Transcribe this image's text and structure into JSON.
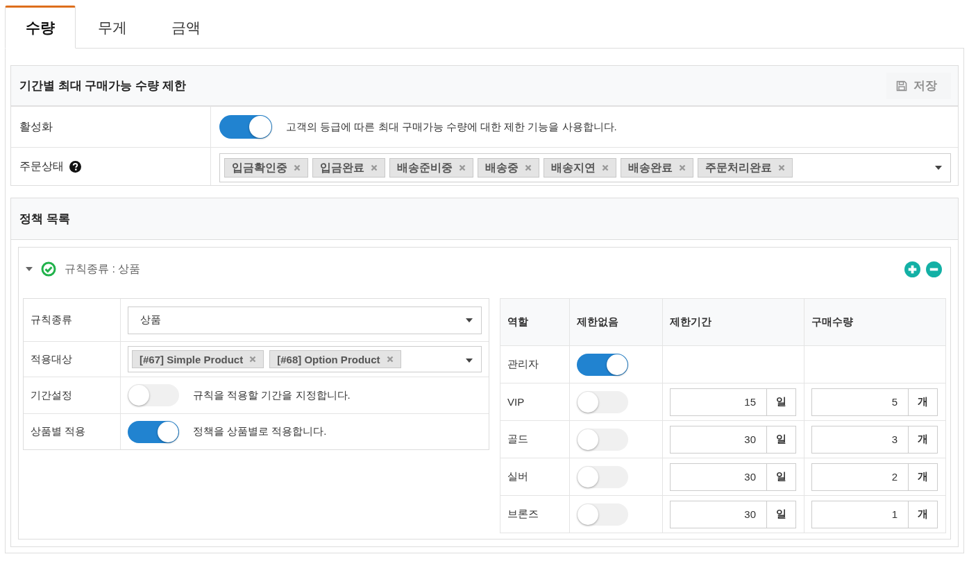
{
  "tabs": [
    {
      "label": "수량",
      "selected": true
    },
    {
      "label": "무게",
      "selected": false
    },
    {
      "label": "금액",
      "selected": false
    }
  ],
  "limit_panel": {
    "title": "기간별 최대 구매가능 수량 제한",
    "save_button": {
      "label": "저장",
      "disabled": true
    },
    "rows": [
      {
        "kind": "toggle",
        "label": "활성화",
        "on": true,
        "description": "고객의 등급에 따른 최대 구매가능 수량에 대한 제한 기능을 사용합니다."
      },
      {
        "kind": "tags",
        "label": "주문상태",
        "tags": [
          "입금확인중",
          "입금완료",
          "배송준비중",
          "배송중",
          "배송지연",
          "배송완료",
          "주문처리완료"
        ]
      }
    ]
  },
  "policy_panel": {
    "title": "정책 목록",
    "rules": [
      {
        "expanded": true,
        "summary": "규칙종류 : 상품",
        "settings": [
          {
            "kind": "select",
            "label": "규칙종류",
            "value": "상품"
          },
          {
            "kind": "tags",
            "label": "적용대상",
            "tags": [
              "[#67] Simple Product",
              "[#68] Option Product"
            ]
          },
          {
            "kind": "toggle",
            "label": "기간설정",
            "on": false,
            "description": "규칙을 적용할 기간을 지정합니다."
          },
          {
            "kind": "toggle",
            "label": "상품별 적용",
            "on": true,
            "description": "정책을 상품별로 적용합니다."
          }
        ],
        "roles": {
          "columns": [
            "역할",
            "제한없음",
            "제한기간",
            "구매수량"
          ],
          "rows": [
            {
              "role": "관리자",
              "unlimited": true
            },
            {
              "role": "VIP",
              "unlimited": false,
              "period": "15",
              "period_unit": "일",
              "quantity": "5",
              "quantity_unit": "개"
            },
            {
              "role": "골드",
              "unlimited": false,
              "period": "30",
              "period_unit": "일",
              "quantity": "3",
              "quantity_unit": "개"
            },
            {
              "role": "실버",
              "unlimited": false,
              "period": "30",
              "period_unit": "일",
              "quantity": "2",
              "quantity_unit": "개"
            },
            {
              "role": "브론즈",
              "unlimited": false,
              "period": "30",
              "period_unit": "일",
              "quantity": "1",
              "quantity_unit": "개"
            }
          ]
        }
      }
    ]
  }
}
